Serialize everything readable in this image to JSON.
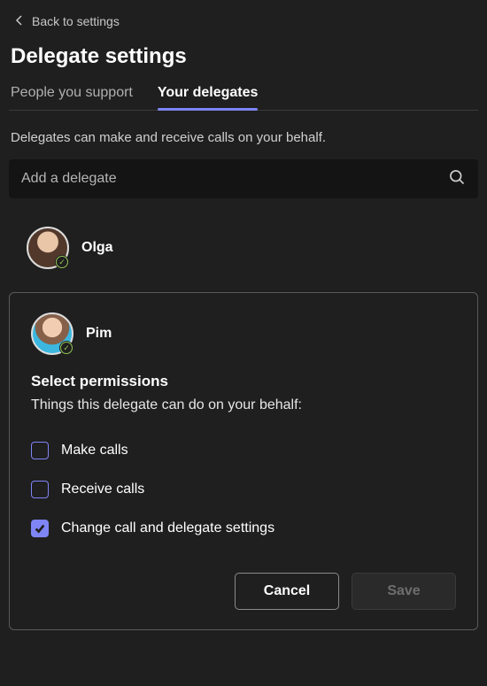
{
  "nav": {
    "back_label": "Back to settings"
  },
  "page_title": "Delegate settings",
  "tabs": [
    {
      "label": "People you support",
      "active": false
    },
    {
      "label": "Your delegates",
      "active": true
    }
  ],
  "description": "Delegates can make and receive calls on your behalf.",
  "search": {
    "placeholder": "Add a delegate"
  },
  "delegates": [
    {
      "name": "Olga"
    }
  ],
  "editing": {
    "name": "Pim",
    "section_title": "Select permissions",
    "section_desc": "Things this delegate can do on your behalf:",
    "permissions": [
      {
        "label": "Make calls",
        "checked": false
      },
      {
        "label": "Receive calls",
        "checked": false
      },
      {
        "label": "Change call and delegate settings",
        "checked": true
      }
    ],
    "cancel_label": "Cancel",
    "save_label": "Save"
  }
}
